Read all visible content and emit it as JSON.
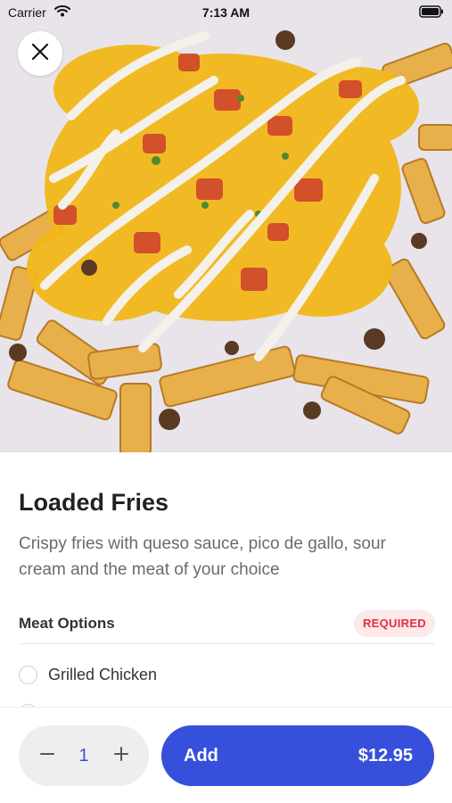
{
  "status_bar": {
    "carrier": "Carrier",
    "time": "7:13 AM",
    "icons": [
      "wifi-icon",
      "battery-icon"
    ]
  },
  "hero": {
    "image": "loaded-fries-photo"
  },
  "close_button": {
    "icon": "close-icon"
  },
  "item": {
    "title": "Loaded Fries",
    "description": "Crispy fries with queso sauce, pico de gallo, sour cream and the meat of your choice"
  },
  "options_section": {
    "title": "Meat Options",
    "badge": "REQUIRED",
    "options": [
      {
        "label": "Grilled Chicken"
      }
    ]
  },
  "bottom_bar": {
    "quantity": "1",
    "minus_icon": "minus-icon",
    "plus_icon": "plus-icon",
    "add_label": "Add",
    "price": "$12.95"
  },
  "colors": {
    "accent": "#3650dc",
    "required_text": "#e0303f",
    "required_bg": "#fde8ea",
    "description_text": "#6b6b6b"
  }
}
